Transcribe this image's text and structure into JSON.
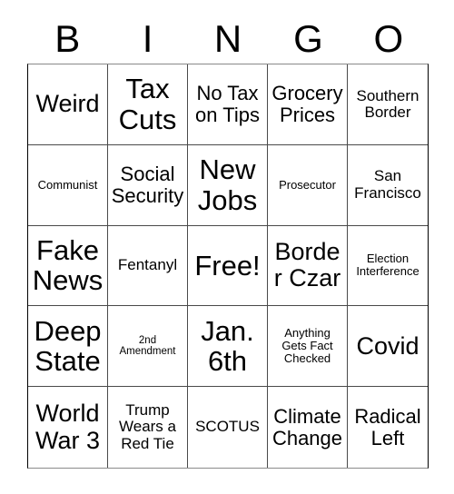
{
  "card": {
    "header_letters": [
      "B",
      "I",
      "N",
      "G",
      "O"
    ],
    "columns": 5,
    "rows": 5,
    "colors": {
      "background": "#ffffff",
      "text": "#000000",
      "grid_line": "#4a4a4a",
      "outer_border": "#000000"
    },
    "cells": [
      {
        "text": "Weird",
        "size": "lg"
      },
      {
        "text": "Tax Cuts",
        "size": "xl"
      },
      {
        "text": "No Tax on Tips",
        "size": "md"
      },
      {
        "text": "Grocery Prices",
        "size": "md"
      },
      {
        "text": "Southern Border",
        "size": "sm"
      },
      {
        "text": "Communist",
        "size": "xs"
      },
      {
        "text": "Social Security",
        "size": "md"
      },
      {
        "text": "New Jobs",
        "size": "xl"
      },
      {
        "text": "Prosecutor",
        "size": "xs"
      },
      {
        "text": "San Francisco",
        "size": "sm"
      },
      {
        "text": "Fake News",
        "size": "xl"
      },
      {
        "text": "Fentanyl",
        "size": "sm"
      },
      {
        "text": "Free!",
        "size": "xl"
      },
      {
        "text": "Border Czar",
        "size": "lg"
      },
      {
        "text": "Election Interference",
        "size": "xs"
      },
      {
        "text": "Deep State",
        "size": "xl"
      },
      {
        "text": "2nd Amendment",
        "size": "xxs"
      },
      {
        "text": "Jan. 6th",
        "size": "xl"
      },
      {
        "text": "Anything Gets Fact Checked",
        "size": "xs"
      },
      {
        "text": "Covid",
        "size": "lg"
      },
      {
        "text": "World War 3",
        "size": "lg"
      },
      {
        "text": "Trump Wears a Red Tie",
        "size": "sm"
      },
      {
        "text": "SCOTUS",
        "size": "sm"
      },
      {
        "text": "Climate Change",
        "size": "md"
      },
      {
        "text": "Radical Left",
        "size": "md"
      }
    ]
  }
}
